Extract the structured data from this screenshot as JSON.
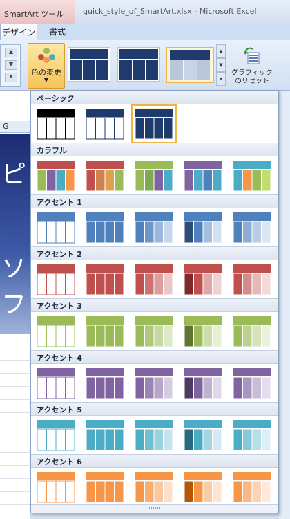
{
  "title_bar": {
    "tool_tab": "SmartArt ツール",
    "window_title": "quick_style_of_SmartArt.xlsx - Microsoft Excel"
  },
  "ribbon_tabs": [
    "デザイン",
    "書式"
  ],
  "ribbon": {
    "change_colors_label": "色の変更",
    "reset_label_line1": "グラフィック",
    "reset_label_line2": "のリセット"
  },
  "sheet": {
    "column_header": "G",
    "slide_text": [
      "ピ",
      "ソフ"
    ]
  },
  "dropdown": {
    "sections": [
      {
        "label": "ベーシック",
        "count": 3,
        "selected": 2,
        "thumbs": [
          {
            "style": "basic-black",
            "header": "#000000",
            "cells": [
              "#ffffff",
              "#ffffff",
              "#ffffff",
              "#ffffff"
            ],
            "border": "#000000"
          },
          {
            "style": "basic-outline",
            "header": "#1f3a6d",
            "cells": [
              "#ffffff",
              "#ffffff",
              "#ffffff",
              "#ffffff"
            ],
            "border": "#1f3a6d"
          },
          {
            "style": "basic-filled",
            "header": "#1f3a6d",
            "cells": [
              "#1f3a6d",
              "#1f3a6d",
              "#1f3a6d",
              "#1f3a6d"
            ],
            "border": "#ffffff"
          }
        ]
      },
      {
        "label": "カラフル",
        "count": 5,
        "selected": -1,
        "thumbs": [
          {
            "style": "colorful-1",
            "header": "#c0504d",
            "cells": [
              "#9bbb59",
              "#8064a2",
              "#4bacc6",
              "#f79646"
            ],
            "border": "#ffffff"
          },
          {
            "style": "colorful-2",
            "header": "#c0504d",
            "cells": [
              "#c0504d",
              "#d08050",
              "#e0a050",
              "#9bbb59"
            ],
            "border": "#ffffff"
          },
          {
            "style": "colorful-3",
            "header": "#9bbb59",
            "cells": [
              "#9bbb59",
              "#7dab4d",
              "#8064a2",
              "#4bacc6"
            ],
            "border": "#ffffff"
          },
          {
            "style": "colorful-4",
            "header": "#8064a2",
            "cells": [
              "#8064a2",
              "#4bacc6",
              "#4f81bd",
              "#4bacc6"
            ],
            "border": "#ffffff"
          },
          {
            "style": "colorful-5",
            "header": "#4bacc6",
            "cells": [
              "#4bacc6",
              "#f79646",
              "#9bbb59",
              "#c0dd70"
            ],
            "border": "#ffffff"
          }
        ]
      },
      {
        "label": "アクセント 1",
        "count": 5,
        "selected": -1,
        "thumbs": [
          {
            "style": "a1-outline",
            "header": "#4f81bd",
            "cells": [
              "#ffffff",
              "#ffffff",
              "#ffffff",
              "#ffffff"
            ],
            "border": "#4f81bd"
          },
          {
            "style": "a1-filled",
            "header": "#4f81bd",
            "cells": [
              "#4f81bd",
              "#4f81bd",
              "#4f81bd",
              "#4f81bd"
            ],
            "border": "#ffffff"
          },
          {
            "style": "a1-gradient",
            "header": "#4f81bd",
            "cells": [
              "#4f81bd",
              "#6f97c9",
              "#9cb7dc",
              "#c6d6ec"
            ],
            "border": "#ffffff"
          },
          {
            "style": "a1-dark",
            "header": "#4f81bd",
            "cells": [
              "#2c4d75",
              "#4f81bd",
              "#a7bfde",
              "#d3e0ef"
            ],
            "border": "#ffffff"
          },
          {
            "style": "a1-light",
            "header": "#4f81bd",
            "cells": [
              "#4f81bd",
              "#8eabd3",
              "#b9cce5",
              "#dbe5f2"
            ],
            "border": "#ffffff"
          }
        ]
      },
      {
        "label": "アクセント 2",
        "count": 5,
        "selected": -1,
        "thumbs": [
          {
            "style": "a2-outline",
            "header": "#c0504d",
            "cells": [
              "#ffffff",
              "#ffffff",
              "#ffffff",
              "#ffffff"
            ],
            "border": "#c0504d"
          },
          {
            "style": "a2-filled",
            "header": "#c0504d",
            "cells": [
              "#c0504d",
              "#c0504d",
              "#c0504d",
              "#c0504d"
            ],
            "border": "#ffffff"
          },
          {
            "style": "a2-gradient",
            "header": "#c0504d",
            "cells": [
              "#c0504d",
              "#cd7370",
              "#dc9e9c",
              "#ebc8c7"
            ],
            "border": "#ffffff"
          },
          {
            "style": "a2-dark",
            "header": "#c0504d",
            "cells": [
              "#7d2a28",
              "#c0504d",
              "#dfa7a6",
              "#efd3d2"
            ],
            "border": "#ffffff"
          },
          {
            "style": "a2-light",
            "header": "#c0504d",
            "cells": [
              "#c0504d",
              "#d48c8a",
              "#e5b9b8",
              "#f2dbdb"
            ],
            "border": "#ffffff"
          }
        ]
      },
      {
        "label": "アクセント 3",
        "count": 5,
        "selected": -1,
        "thumbs": [
          {
            "style": "a3-outline",
            "header": "#9bbb59",
            "cells": [
              "#ffffff",
              "#ffffff",
              "#ffffff",
              "#ffffff"
            ],
            "border": "#9bbb59"
          },
          {
            "style": "a3-filled",
            "header": "#9bbb59",
            "cells": [
              "#9bbb59",
              "#9bbb59",
              "#9bbb59",
              "#9bbb59"
            ],
            "border": "#ffffff"
          },
          {
            "style": "a3-gradient",
            "header": "#9bbb59",
            "cells": [
              "#9bbb59",
              "#afc97a",
              "#c6d9a0",
              "#dce8c6"
            ],
            "border": "#ffffff"
          },
          {
            "style": "a3-dark",
            "header": "#9bbb59",
            "cells": [
              "#5f7530",
              "#9bbb59",
              "#cddda9",
              "#e6eed4"
            ],
            "border": "#ffffff"
          },
          {
            "style": "a3-light",
            "header": "#9bbb59",
            "cells": [
              "#9bbb59",
              "#bcd18f",
              "#d5e3b9",
              "#eaf1dc"
            ],
            "border": "#ffffff"
          }
        ]
      },
      {
        "label": "アクセント 4",
        "count": 5,
        "selected": -1,
        "thumbs": [
          {
            "style": "a4-outline",
            "header": "#8064a2",
            "cells": [
              "#ffffff",
              "#ffffff",
              "#ffffff",
              "#ffffff"
            ],
            "border": "#8064a2"
          },
          {
            "style": "a4-filled",
            "header": "#8064a2",
            "cells": [
              "#8064a2",
              "#8064a2",
              "#8064a2",
              "#8064a2"
            ],
            "border": "#ffffff"
          },
          {
            "style": "a4-gradient",
            "header": "#8064a2",
            "cells": [
              "#8064a2",
              "#9a83b5",
              "#b7a6ca",
              "#d6cce2"
            ],
            "border": "#ffffff"
          },
          {
            "style": "a4-dark",
            "header": "#8064a2",
            "cells": [
              "#4d3b63",
              "#8064a2",
              "#bfb1d1",
              "#dfd8e8"
            ],
            "border": "#ffffff"
          },
          {
            "style": "a4-light",
            "header": "#8064a2",
            "cells": [
              "#8064a2",
              "#a896c1",
              "#c8bcd9",
              "#e4ddee"
            ],
            "border": "#ffffff"
          }
        ]
      },
      {
        "label": "アクセント 5",
        "count": 5,
        "selected": -1,
        "thumbs": [
          {
            "style": "a5-outline",
            "header": "#4bacc6",
            "cells": [
              "#ffffff",
              "#ffffff",
              "#ffffff",
              "#ffffff"
            ],
            "border": "#4bacc6"
          },
          {
            "style": "a5-filled",
            "header": "#4bacc6",
            "cells": [
              "#4bacc6",
              "#4bacc6",
              "#4bacc6",
              "#4bacc6"
            ],
            "border": "#ffffff"
          },
          {
            "style": "a5-gradient",
            "header": "#4bacc6",
            "cells": [
              "#4bacc6",
              "#6fbfd3",
              "#9bd2e1",
              "#c5e5ee"
            ],
            "border": "#ffffff"
          },
          {
            "style": "a5-dark",
            "header": "#4bacc6",
            "cells": [
              "#266b7e",
              "#4bacc6",
              "#a5d5e2",
              "#d2eaf0"
            ],
            "border": "#ffffff"
          },
          {
            "style": "a5-light",
            "header": "#4bacc6",
            "cells": [
              "#4bacc6",
              "#87c9da",
              "#b7dfea",
              "#dbeff5"
            ],
            "border": "#ffffff"
          }
        ]
      },
      {
        "label": "アクセント 6",
        "count": 5,
        "selected": -1,
        "thumbs": [
          {
            "style": "a6-outline",
            "header": "#f79646",
            "cells": [
              "#ffffff",
              "#ffffff",
              "#ffffff",
              "#ffffff"
            ],
            "border": "#f79646"
          },
          {
            "style": "a6-filled",
            "header": "#f79646",
            "cells": [
              "#f79646",
              "#f79646",
              "#f79646",
              "#f79646"
            ],
            "border": "#ffffff"
          },
          {
            "style": "a6-gradient",
            "header": "#f79646",
            "cells": [
              "#f79646",
              "#f9ad6e",
              "#fbc79c",
              "#fde0c8"
            ],
            "border": "#ffffff"
          },
          {
            "style": "a6-dark",
            "header": "#f79646",
            "cells": [
              "#b65708",
              "#f79646",
              "#fbcba3",
              "#fde5d1"
            ],
            "border": "#ffffff"
          },
          {
            "style": "a6-light",
            "header": "#f79646",
            "cells": [
              "#f79646",
              "#fab888",
              "#fcd4b5",
              "#feeadb"
            ],
            "border": "#ffffff"
          }
        ]
      }
    ]
  }
}
